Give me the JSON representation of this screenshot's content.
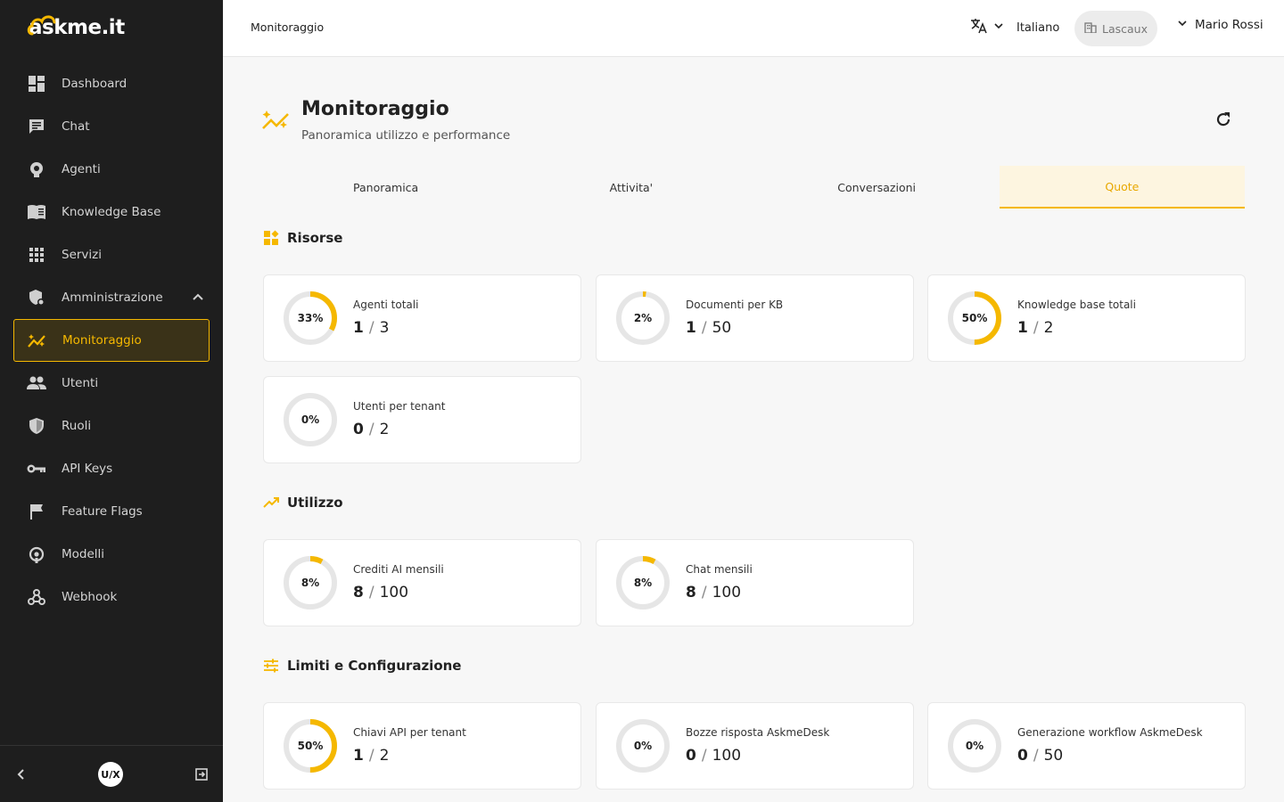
{
  "brand": {
    "name": "askme.it",
    "accent": "#f5b800",
    "sidebar_bg": "#1e1e1e"
  },
  "sidebar": {
    "items": [
      {
        "label": "Dashboard",
        "icon": "dashboard-icon"
      },
      {
        "label": "Chat",
        "icon": "chat-icon"
      },
      {
        "label": "Agenti",
        "icon": "agent-icon"
      },
      {
        "label": "Knowledge Base",
        "icon": "book-icon"
      },
      {
        "label": "Servizi",
        "icon": "grid-icon"
      },
      {
        "label": "Amministrazione",
        "icon": "admin-shield-icon",
        "expanded": true
      },
      {
        "label": "Monitoraggio",
        "icon": "monitoring-icon",
        "active": true
      },
      {
        "label": "Utenti",
        "icon": "users-icon"
      },
      {
        "label": "Ruoli",
        "icon": "shield-icon"
      },
      {
        "label": "API Keys",
        "icon": "key-icon"
      },
      {
        "label": "Feature Flags",
        "icon": "flag-icon"
      },
      {
        "label": "Modelli",
        "icon": "model-icon"
      },
      {
        "label": "Webhook",
        "icon": "webhook-icon"
      }
    ],
    "footer_badge": "U/X"
  },
  "header": {
    "breadcrumb": "Monitoraggio",
    "language": "Italiano",
    "tenant": "Lascaux",
    "user": "Mario Rossi"
  },
  "page": {
    "title": "Monitoraggio",
    "subtitle": "Panoramica utilizzo e performance",
    "tabs": [
      {
        "label": "Panoramica"
      },
      {
        "label": "Attivita'"
      },
      {
        "label": "Conversazioni"
      },
      {
        "label": "Quote",
        "active": true
      }
    ]
  },
  "sections": {
    "risorse": {
      "title": "Risorse",
      "cards": [
        {
          "label": "Agenti totali",
          "used": "1",
          "limit": "3",
          "pct_label": "33%",
          "pct": 33
        },
        {
          "label": "Documenti per KB",
          "used": "1",
          "limit": "50",
          "pct_label": "2%",
          "pct": 2
        },
        {
          "label": "Knowledge base totali",
          "used": "1",
          "limit": "2",
          "pct_label": "50%",
          "pct": 50
        },
        {
          "label": "Utenti per tenant",
          "used": "0",
          "limit": "2",
          "pct_label": "0%",
          "pct": 0
        }
      ]
    },
    "utilizzo": {
      "title": "Utilizzo",
      "cards": [
        {
          "label": "Crediti AI mensili",
          "used": "8",
          "limit": "100",
          "pct_label": "8%",
          "pct": 8
        },
        {
          "label": "Chat mensili",
          "used": "8",
          "limit": "100",
          "pct_label": "8%",
          "pct": 8
        }
      ]
    },
    "limiti": {
      "title": "Limiti e Configurazione",
      "cards": [
        {
          "label": "Chiavi API per tenant",
          "used": "1",
          "limit": "2",
          "pct_label": "50%",
          "pct": 50
        },
        {
          "label": "Bozze risposta AskmeDesk",
          "used": "0",
          "limit": "100",
          "pct_label": "0%",
          "pct": 0
        },
        {
          "label": "Generazione workflow AskmeDesk",
          "used": "0",
          "limit": "50",
          "pct_label": "0%",
          "pct": 0
        }
      ]
    }
  }
}
